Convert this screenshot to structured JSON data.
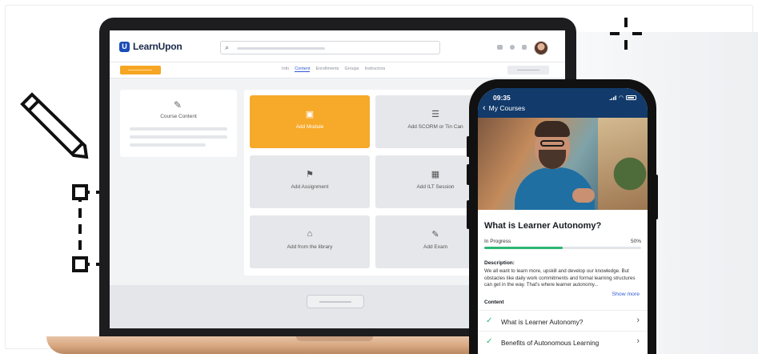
{
  "laptop_app": {
    "logo": "LearnUpon",
    "logo_mark": "U",
    "tabs": [
      "Info",
      "Content",
      "Enrollments",
      "Groups",
      "Instructors"
    ],
    "active_tab": "Content",
    "left_card_title": "Course Content",
    "tiles": [
      {
        "label": "Add Module",
        "icon": "file-icon",
        "glyph": "▣"
      },
      {
        "label": "Add SCORM or Tin Can",
        "icon": "package-icon",
        "glyph": "☰"
      },
      {
        "label": "Add Assignment",
        "icon": "flag-icon",
        "glyph": "⚑"
      },
      {
        "label": "Add ILT Session",
        "icon": "calendar-icon",
        "glyph": "▦"
      },
      {
        "label": "Add from the library",
        "icon": "library-icon",
        "glyph": "⌂"
      },
      {
        "label": "Add Exam",
        "icon": "edit-icon",
        "glyph": "✎"
      }
    ]
  },
  "phone": {
    "time": "09:35",
    "back_label": "My Courses",
    "course_title": "What is Learner Autonomy?",
    "progress_label": "In Progress",
    "progress_percent": "50%",
    "progress_value": 0.5,
    "description_heading": "Description:",
    "description": "We all want to learn more, upskill and develop our knowledge. But obstacles like daily work commitments and formal learning structures can get in the way. That's where learner autonomy...",
    "show_more": "Show more",
    "content_heading": "Content",
    "lessons": [
      "What is Learner Autonomy?",
      "Benefits of Autonomous Learning"
    ]
  },
  "colors": {
    "accent_orange": "#f7a929",
    "nav_blue": "#123a6b",
    "progress_green": "#2bb673",
    "link_blue": "#2f5ad2"
  }
}
